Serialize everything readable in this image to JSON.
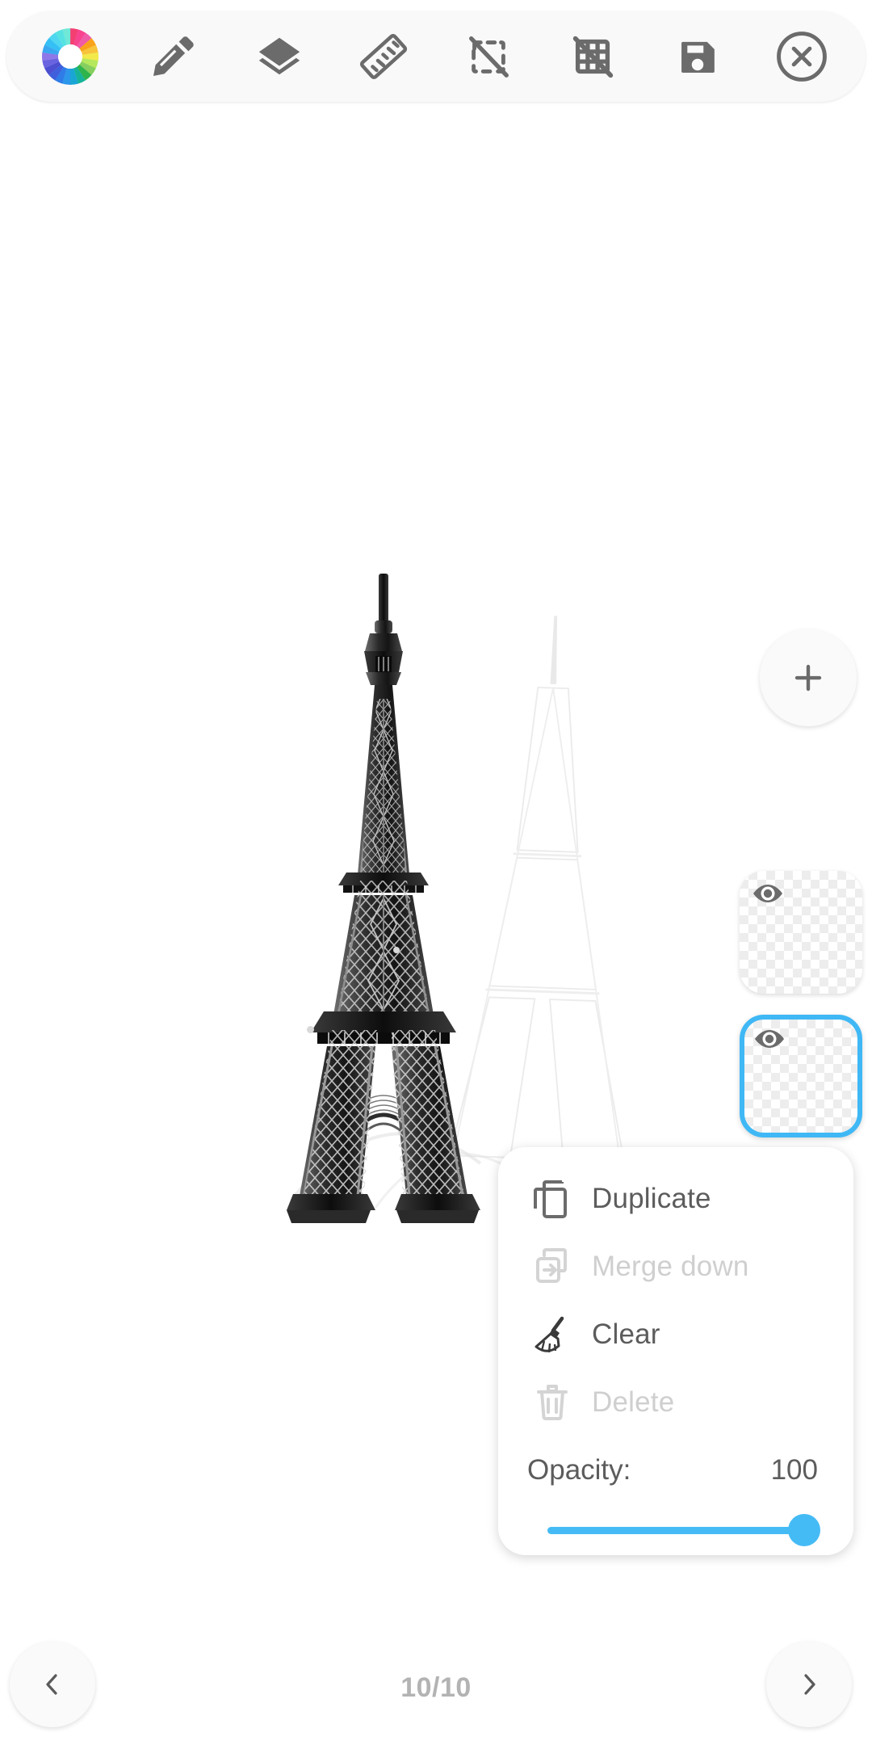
{
  "app": {
    "accent_color": "#3fb8f5",
    "slider_color": "#45bbf5",
    "icon_color": "#6b6b6b",
    "disabled_color": "#d4d4d4",
    "canvas_background": "#ffffff"
  },
  "toolbar": {
    "tools": [
      {
        "name": "color-wheel-icon",
        "label": "Color"
      },
      {
        "name": "pencil-icon",
        "label": "Draw"
      },
      {
        "name": "layers-icon",
        "label": "Layers"
      },
      {
        "name": "ruler-icon",
        "label": "Ruler"
      },
      {
        "name": "selection-off-icon",
        "label": "Selection off"
      },
      {
        "name": "grid-off-icon",
        "label": "Grid off"
      },
      {
        "name": "save-icon",
        "label": "Save"
      },
      {
        "name": "close-icon",
        "label": "Close"
      }
    ],
    "color_wheel_segments": [
      "#f43f72",
      "#f8438f",
      "#f05ba8",
      "#f9a21b",
      "#f8c43c",
      "#f2e94a",
      "#b5e85c",
      "#86cf5e",
      "#2fb34d",
      "#16b39a",
      "#1aa6d4",
      "#2c96ea",
      "#2f7ce8",
      "#3f5fdc",
      "#4c4fcf",
      "#6a63e0",
      "#8e77e8",
      "#3aa8f0",
      "#35c0f5",
      "#4fd6f0",
      "#57e2e2",
      "#6fe8d8"
    ]
  },
  "canvas": {
    "artwork_title": "Eiffel Tower sketch",
    "artwork_description": "Black and white pencil drawing of the Eiffel Tower with a faded ghost duplicate to the right"
  },
  "layers_panel": {
    "add_button_label": "+",
    "add_button_name": "add-layer-button",
    "layers": [
      {
        "id": "layer-1",
        "visible": true,
        "selected": false,
        "eye_label": "visible"
      },
      {
        "id": "layer-2",
        "visible": true,
        "selected": true,
        "eye_label": "visible"
      }
    ]
  },
  "layer_menu": {
    "items": [
      {
        "label": "Duplicate",
        "icon": "duplicate-icon",
        "enabled": true
      },
      {
        "label": "Merge down",
        "icon": "merge-down-icon",
        "enabled": false
      },
      {
        "label": "Clear",
        "icon": "broom-icon",
        "enabled": true
      },
      {
        "label": "Delete",
        "icon": "trash-icon",
        "enabled": false
      }
    ],
    "opacity": {
      "label": "Opacity:",
      "value": "100",
      "min": 0,
      "max": 100,
      "percent": 100
    }
  },
  "bottom_nav": {
    "prev_label": "‹",
    "next_label": "›",
    "page_indicator": "10/10"
  }
}
